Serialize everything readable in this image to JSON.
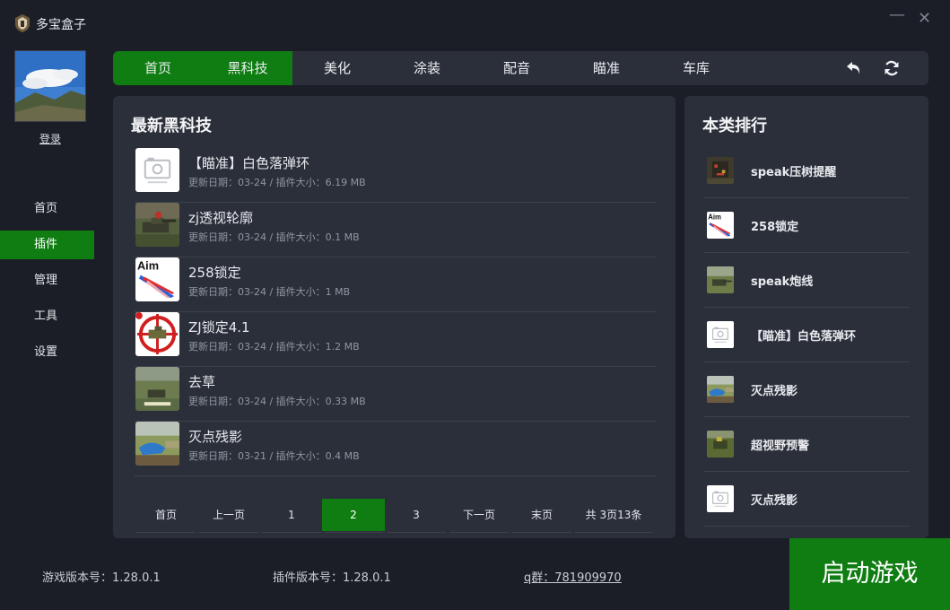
{
  "app": {
    "title": "多宝盒子",
    "minimize": "—",
    "close": "✕"
  },
  "sidebar": {
    "login_label": "登录",
    "items": [
      {
        "label": "首页",
        "active": false
      },
      {
        "label": "插件",
        "active": true
      },
      {
        "label": "管理",
        "active": false
      },
      {
        "label": "工具",
        "active": false
      },
      {
        "label": "设置",
        "active": false
      }
    ]
  },
  "topnav": {
    "tabs": [
      {
        "label": "首页",
        "highlighted": true
      },
      {
        "label": "黑科技",
        "highlighted": true
      },
      {
        "label": "美化",
        "highlighted": false
      },
      {
        "label": "涂装",
        "highlighted": false
      },
      {
        "label": "配音",
        "highlighted": false
      },
      {
        "label": "瞄准",
        "highlighted": false
      },
      {
        "label": "车库",
        "highlighted": false
      }
    ],
    "icons": [
      "back-icon",
      "refresh-icon"
    ]
  },
  "main": {
    "title": "最新黑科技",
    "items": [
      {
        "name": "【瞄准】白色落弹环",
        "meta": "更新日期：03-24 / 插件大小：6.19 MB",
        "thumb": "placeholder-image-icon"
      },
      {
        "name": "zj透视轮廓",
        "meta": "更新日期：03-24 / 插件大小：0.1 MB",
        "thumb": "tank-scene"
      },
      {
        "name": "258锁定",
        "meta": "更新日期：03-24 / 插件大小：1 MB",
        "thumb": "aim-logo"
      },
      {
        "name": "ZJ锁定4.1",
        "meta": "更新日期：03-24 / 插件大小：1.2 MB",
        "thumb": "crosshair-target"
      },
      {
        "name": "去草",
        "meta": "更新日期：03-24 / 插件大小：0.33 MB",
        "thumb": "grass-scene"
      },
      {
        "name": "灭点残影",
        "meta": "更新日期：03-21 / 插件大小：0.4 MB",
        "thumb": "field-scene"
      }
    ],
    "pager": {
      "first": "首页",
      "prev": "上一页",
      "pages": [
        "1",
        "2",
        "3"
      ],
      "current": "2",
      "next": "下一页",
      "last": "末页",
      "summary": "共 3页13条"
    }
  },
  "rank": {
    "title": "本类排行",
    "items": [
      {
        "name": "speak压树提醒",
        "thumb": "tank-dark"
      },
      {
        "name": "258锁定",
        "thumb": "aim-logo"
      },
      {
        "name": "speak炮线",
        "thumb": "tank-field"
      },
      {
        "name": "【瞄准】白色落弹环",
        "thumb": "placeholder-image-icon"
      },
      {
        "name": "灭点残影",
        "thumb": "field-scene"
      },
      {
        "name": "超视野预警",
        "thumb": "tank-green"
      },
      {
        "name": "灭点残影",
        "thumb": "placeholder-image-icon"
      }
    ]
  },
  "footer": {
    "game_version": "游戏版本号：1.28.0.1",
    "plugin_version": "插件版本号：1.28.0.1",
    "qq_group": "q群：781909970",
    "launch_label": "启动游戏"
  },
  "colors": {
    "accent": "#0f7d12",
    "background": "#1b1e26",
    "panel": "#2b2f3a"
  }
}
